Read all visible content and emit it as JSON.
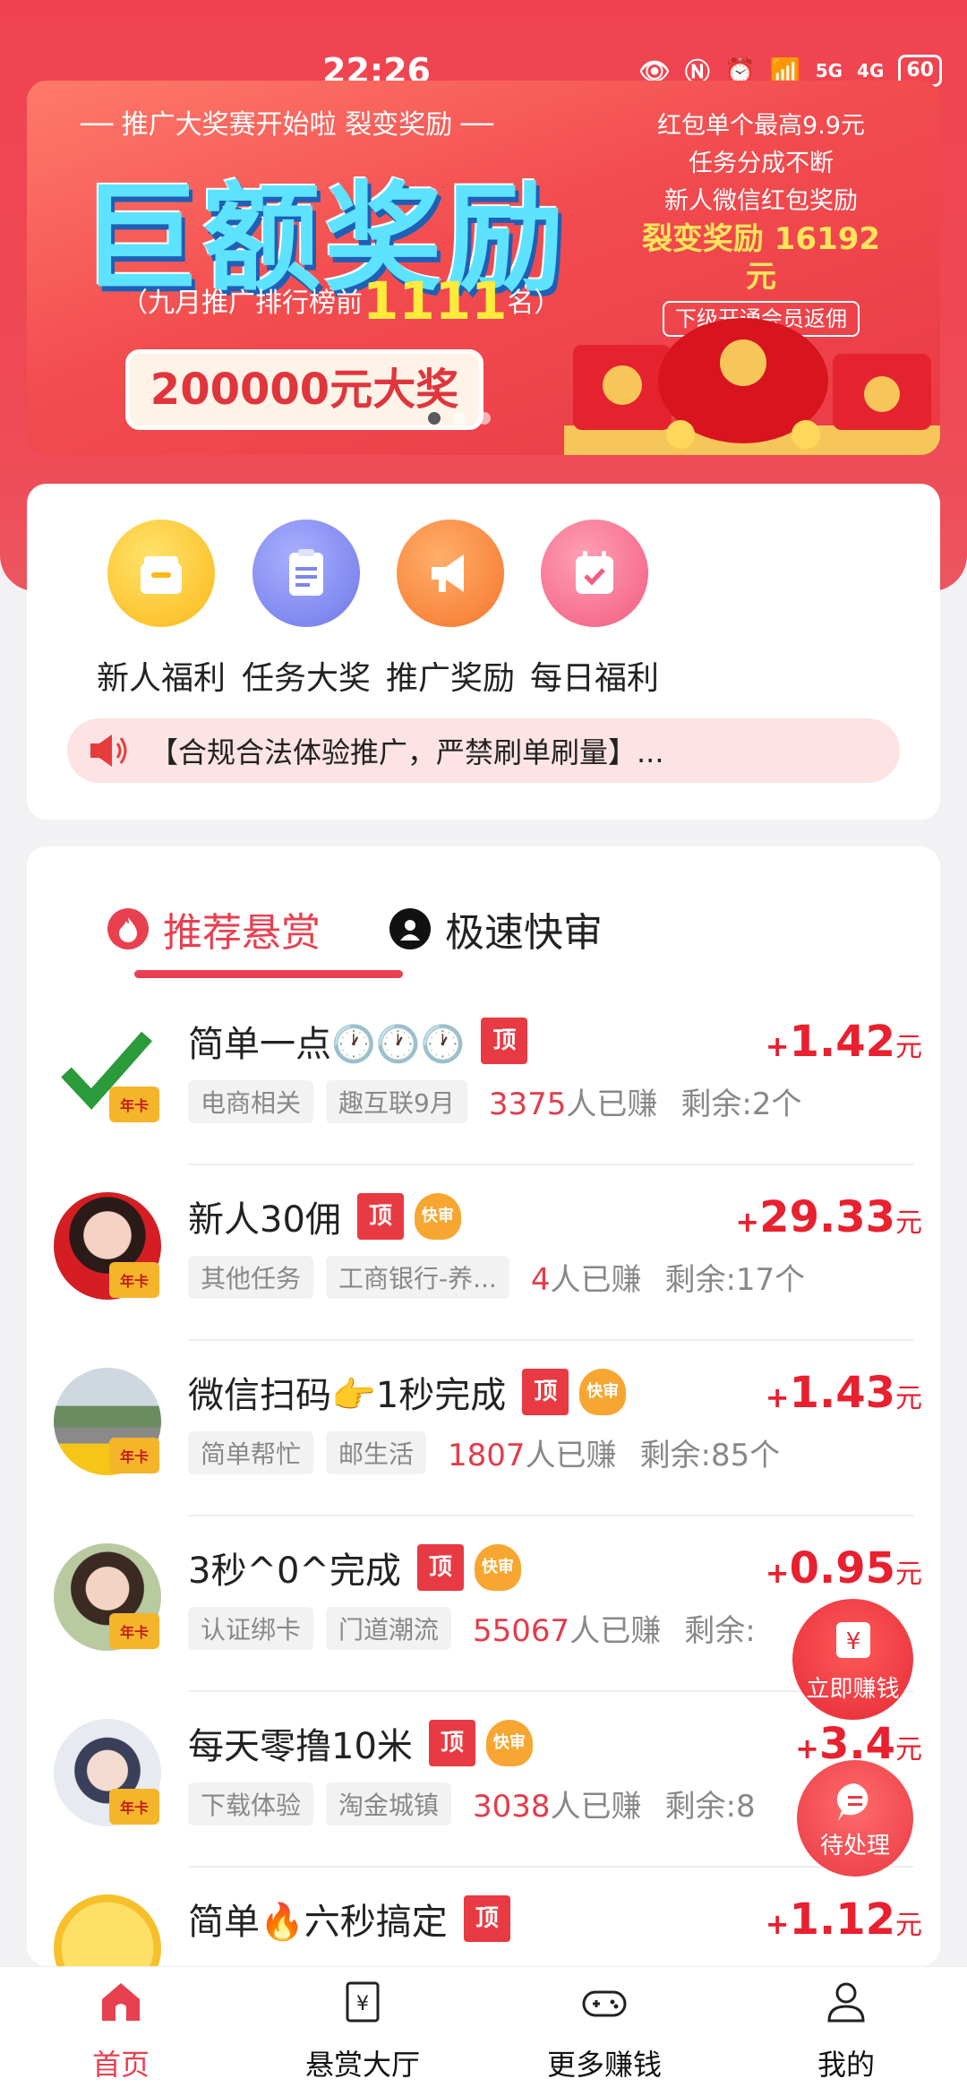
{
  "status_bar": {
    "time": "22:26",
    "battery": "60",
    "sig1": "5G",
    "sig2": "4G"
  },
  "banner": {
    "headline_small": "── 推广大奖赛开始啦  裂变奖励 ──",
    "headline_big": "巨额奖励",
    "rank_prefix": "（九月推广排行榜前",
    "rank_number": "1111",
    "rank_suffix": "名）",
    "prize": "200000元大奖",
    "right_line1": "红包单个最高9.9元",
    "right_line2": "任务分成不断",
    "right_line3": "新人微信红包奖励",
    "right_highlight": "裂变奖励 16192元",
    "right_pill": "下级开通会员返佣"
  },
  "quick_menu": [
    {
      "label": "新人福利",
      "color": "#fcc624",
      "icon": "gift-box-icon"
    },
    {
      "label": "任务大奖",
      "color": "#8b93ef",
      "icon": "clipboard-icon"
    },
    {
      "label": "推广奖励",
      "color": "#f98b3c",
      "icon": "megaphone-icon"
    },
    {
      "label": "每日福利",
      "color": "#f77896",
      "icon": "calendar-check-icon"
    }
  ],
  "notice": {
    "text": "【合规合法体验推广，严禁刷单刷量】..."
  },
  "tabs": {
    "recommended": "推荐悬赏",
    "fast": "极速快审"
  },
  "badges": {
    "top": "顶",
    "fast": "快审",
    "year_card": "年卡",
    "yuan": "元",
    "plus": "+",
    "earned_suffix": "人已赚"
  },
  "tasks": [
    {
      "title": "简单一点🕐🕐🕐",
      "fast": false,
      "tag1": "电商相关",
      "tag2": "趣互联9月",
      "earned": "3375",
      "remain": "剩余:2个",
      "price": "1.42"
    },
    {
      "title": "新人30佣",
      "fast": true,
      "tag1": "其他任务",
      "tag2": "工商银行-养...",
      "earned": "4",
      "remain": "剩余:17个",
      "price": "29.33"
    },
    {
      "title": "微信扫码👉1秒完成",
      "fast": true,
      "tag1": "简单帮忙",
      "tag2": "邮生活",
      "earned": "1807",
      "remain": "剩余:85个",
      "price": "1.43"
    },
    {
      "title": "3秒^0^完成",
      "fast": true,
      "tag1": "认证绑卡",
      "tag2": "门道潮流",
      "earned": "55067",
      "remain": "剩余:",
      "price": "0.95"
    },
    {
      "title": "每天零撸10米",
      "fast": true,
      "tag1": "下载体验",
      "tag2": "淘金城镇",
      "earned": "3038",
      "remain": "剩余:8",
      "price": "3.4"
    },
    {
      "title": "简单🔥六秒搞定",
      "fast": false,
      "tag1": "",
      "tag2": "",
      "earned": "",
      "remain": "",
      "price": "1.12"
    }
  ],
  "fabs": {
    "earn": "立即赚钱",
    "todo": "待处理"
  },
  "bottom_nav": [
    {
      "label": "首页",
      "icon": "home-icon"
    },
    {
      "label": "悬赏大厅",
      "icon": "yuan-ticket-icon"
    },
    {
      "label": "更多赚钱",
      "icon": "gamepad-icon"
    },
    {
      "label": "我的",
      "icon": "user-icon"
    }
  ],
  "colors": {
    "accent": "#e8404f",
    "price": "#e8202f",
    "header": "#f0434f"
  }
}
